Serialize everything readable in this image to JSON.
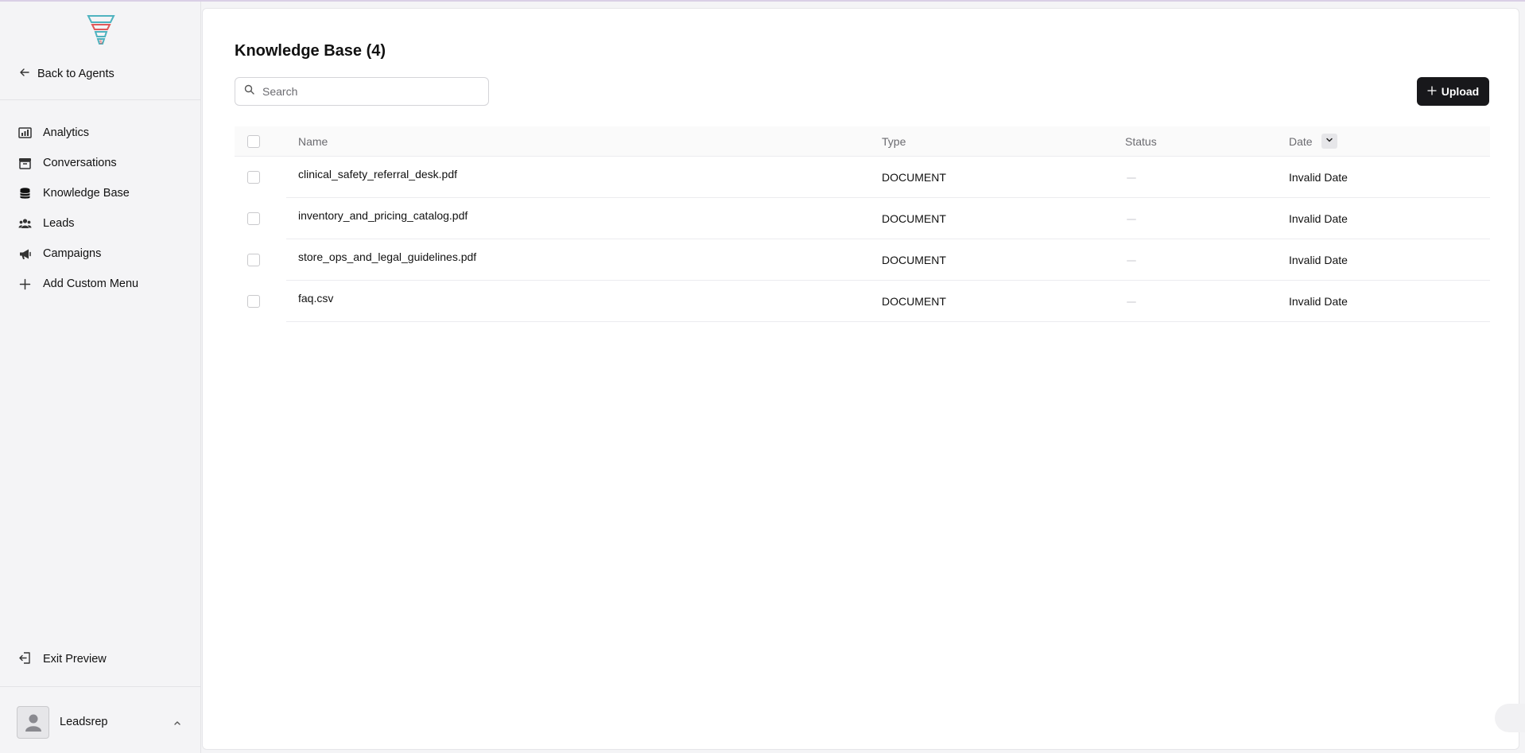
{
  "sidebar": {
    "back_label": "Back to Agents",
    "items": [
      {
        "label": "Analytics",
        "icon": "analytics-icon"
      },
      {
        "label": "Conversations",
        "icon": "inbox-icon"
      },
      {
        "label": "Knowledge Base",
        "icon": "database-icon"
      },
      {
        "label": "Leads",
        "icon": "users-icon"
      },
      {
        "label": "Campaigns",
        "icon": "megaphone-icon"
      },
      {
        "label": "Add Custom Menu",
        "icon": "plus-icon"
      }
    ],
    "exit_label": "Exit Preview",
    "user_name": "Leadsrep"
  },
  "main": {
    "title": "Knowledge Base (4)",
    "search": {
      "placeholder": "Search",
      "value": ""
    },
    "upload_label": "Upload"
  },
  "table": {
    "headers": {
      "name": "Name",
      "type": "Type",
      "status": "Status",
      "date": "Date"
    },
    "rows": [
      {
        "name": "clinical_safety_referral_desk.pdf",
        "type": "DOCUMENT",
        "status": "",
        "date": "Invalid Date"
      },
      {
        "name": "inventory_and_pricing_catalog.pdf",
        "type": "DOCUMENT",
        "status": "",
        "date": "Invalid Date"
      },
      {
        "name": "store_ops_and_legal_guidelines.pdf",
        "type": "DOCUMENT",
        "status": "",
        "date": "Invalid Date"
      },
      {
        "name": "faq.csv",
        "type": "DOCUMENT",
        "status": "",
        "date": "Invalid Date"
      }
    ]
  },
  "colors": {
    "accent": "#18181b",
    "logo_teal": "#4fb3bf",
    "logo_red": "#e05a5a"
  }
}
